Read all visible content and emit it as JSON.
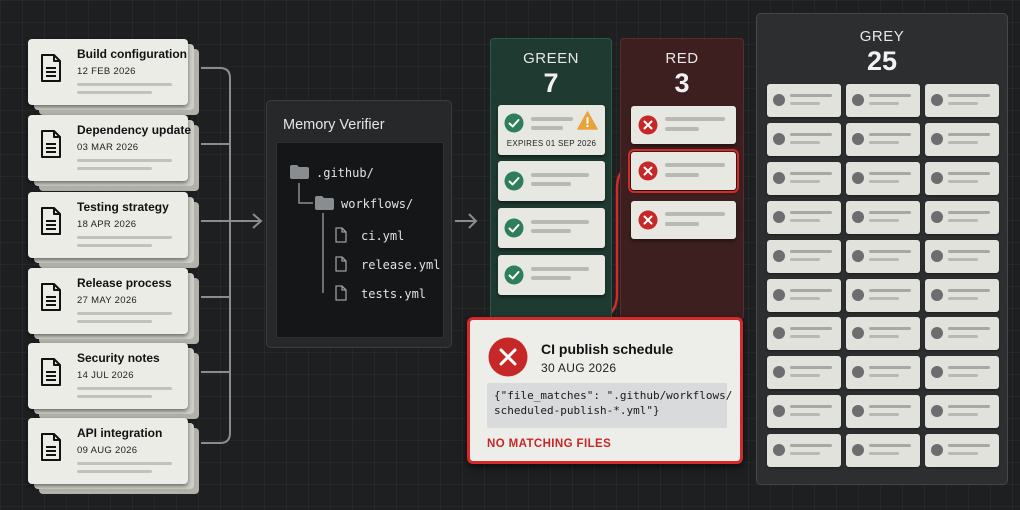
{
  "memories": [
    {
      "title": "Build configuration",
      "date": "12 FEB 2026"
    },
    {
      "title": "Dependency update",
      "date": "03 MAR 2026"
    },
    {
      "title": "Testing strategy",
      "date": "18 APR 2026"
    },
    {
      "title": "Release process",
      "date": "27 MAY 2026"
    },
    {
      "title": "Security notes",
      "date": "14 JUL 2026"
    },
    {
      "title": "API integration",
      "date": "09 AUG 2026"
    }
  ],
  "verifier": {
    "title": "Memory Verifier",
    "tree": [
      ".github/",
      "workflows/",
      "ci.yml",
      "release.yml",
      "tests.yml"
    ]
  },
  "columns": {
    "green": {
      "label": "GREEN",
      "count": "7",
      "color": "#2e7d5b",
      "expires_note": "EXPIRES 01 SEP 2026"
    },
    "red": {
      "label": "RED",
      "count": "3",
      "color": "#c62828"
    },
    "grey": {
      "label": "GREY",
      "count": "25",
      "color": "#6b6d6f"
    }
  },
  "detail": {
    "title": "CI publish schedule",
    "date": "30 AUG 2026",
    "code_line1": "{\"file_matches\": \".github/workflows/",
    "code_line2": "scheduled-publish-*.yml\"}",
    "status": "NO MATCHING FILES"
  },
  "icons": {
    "memory_card": "document-icon",
    "verifier_folder": "folder-icon",
    "verifier_file": "file-icon",
    "green_card": "check-circle-icon",
    "warning": "warning-triangle-icon",
    "red_card": "x-circle-icon"
  },
  "colors": {
    "background": "#1d1f21",
    "card": "#ececE7",
    "warning": "#e8a33a",
    "highlight_red": "#d42a2a"
  }
}
